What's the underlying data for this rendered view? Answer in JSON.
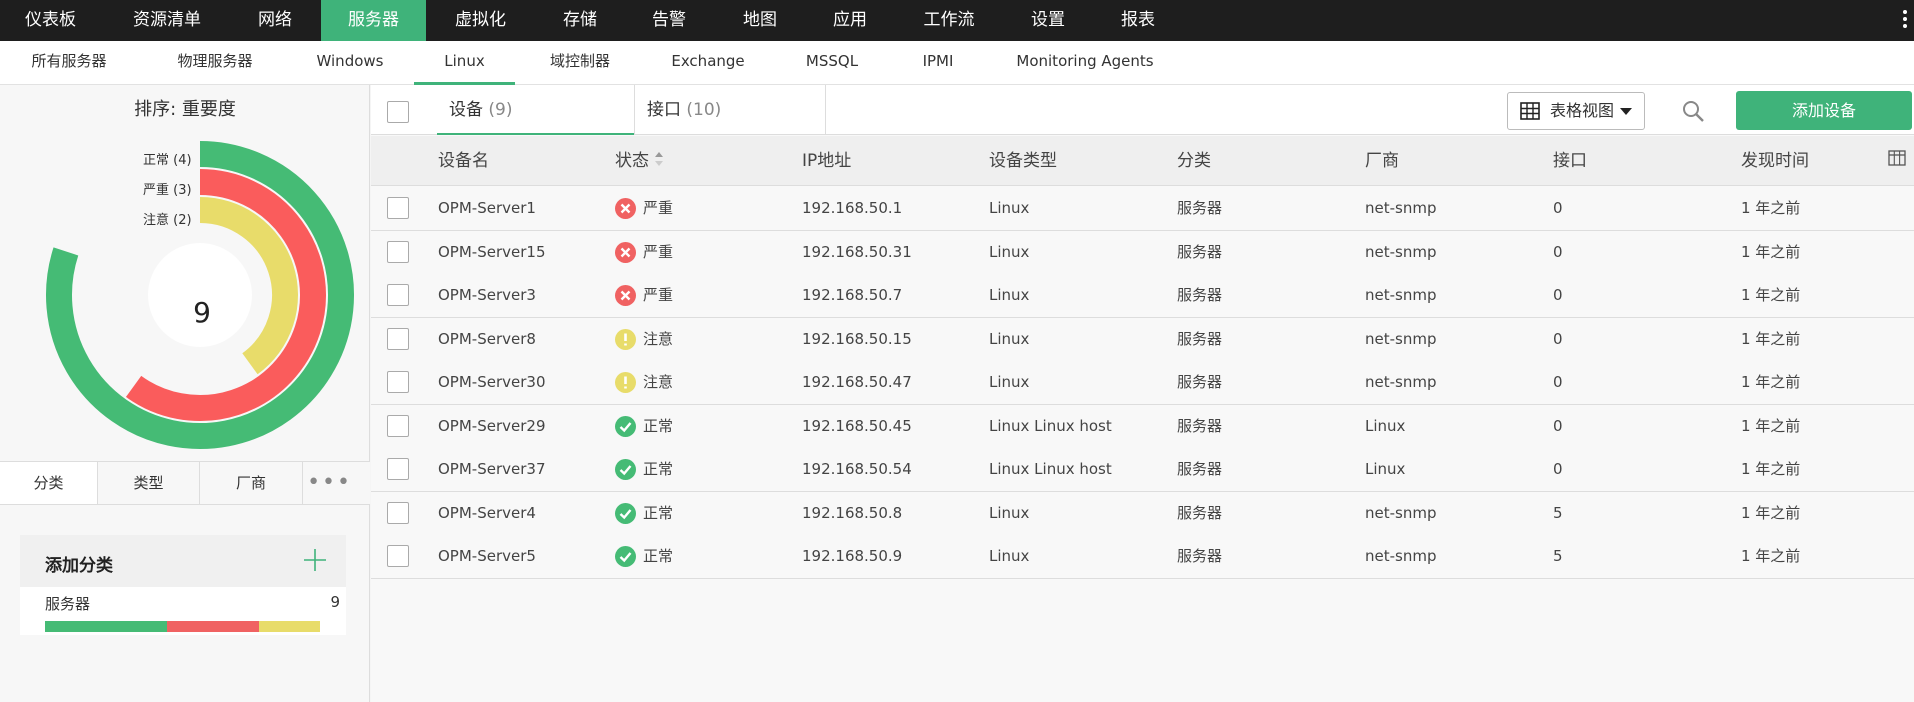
{
  "topnav": [
    "仪表板",
    "资源清单",
    "网络",
    "服务器",
    "虚拟化",
    "存储",
    "告警",
    "地图",
    "应用",
    "工作流",
    "设置",
    "报表"
  ],
  "topnav_active": "服务器",
  "subnav": [
    "所有服务器",
    "物理服务器",
    "Windows",
    "Linux",
    "域控制器",
    "Exchange",
    "MSSQL",
    "IPMI",
    "Monitoring Agents"
  ],
  "subnav_active": "Linux",
  "left": {
    "sort_label": "排序:  重要度",
    "total": "9",
    "legend": [
      {
        "label": "正常 (4)",
        "color": "#45bb75"
      },
      {
        "label": "严重 (3)",
        "color": "#fa5c5c"
      },
      {
        "label": "注意 (2)",
        "color": "#e8dc6a"
      }
    ],
    "donut_fractions": {
      "normal": 0.8,
      "critical": 0.6,
      "attention": 0.4
    },
    "tabs": [
      "分类",
      "类型",
      "厂商"
    ],
    "category_header": "添加分类",
    "category": {
      "name": "服务器",
      "count": "9",
      "bar": [
        0.4,
        0.3,
        0.2
      ]
    }
  },
  "toolbar": {
    "tab_devices": "设备",
    "tab_devices_count": "(9)",
    "tab_interfaces": "接口",
    "tab_interfaces_count": "(10)",
    "view_label": "表格视图",
    "add_label": "添加设备"
  },
  "table": {
    "headers": [
      "设备名",
      "状态",
      "IP地址",
      "设备类型",
      "分类",
      "厂商",
      "接口",
      "发现时间"
    ],
    "rows": [
      {
        "name": "OPM-Server1",
        "status": "严重",
        "kind": "critical",
        "ip": "192.168.50.1",
        "type": "Linux",
        "cat": "服务器",
        "vendor": "net-snmp",
        "ifc": "0",
        "time": "1 年之前"
      },
      {
        "name": "OPM-Server15",
        "status": "严重",
        "kind": "critical",
        "ip": "192.168.50.31",
        "type": "Linux",
        "cat": "服务器",
        "vendor": "net-snmp",
        "ifc": "0",
        "time": "1 年之前"
      },
      {
        "name": "OPM-Server3",
        "status": "严重",
        "kind": "critical",
        "ip": "192.168.50.7",
        "type": "Linux",
        "cat": "服务器",
        "vendor": "net-snmp",
        "ifc": "0",
        "time": "1 年之前"
      },
      {
        "name": "OPM-Server8",
        "status": "注意",
        "kind": "attention",
        "ip": "192.168.50.15",
        "type": "Linux",
        "cat": "服务器",
        "vendor": "net-snmp",
        "ifc": "0",
        "time": "1 年之前"
      },
      {
        "name": "OPM-Server30",
        "status": "注意",
        "kind": "attention",
        "ip": "192.168.50.47",
        "type": "Linux",
        "cat": "服务器",
        "vendor": "net-snmp",
        "ifc": "0",
        "time": "1 年之前"
      },
      {
        "name": "OPM-Server29",
        "status": "正常",
        "kind": "normal",
        "ip": "192.168.50.45",
        "type": "Linux Linux host",
        "cat": "服务器",
        "vendor": "Linux",
        "ifc": "0",
        "time": "1 年之前"
      },
      {
        "name": "OPM-Server37",
        "status": "正常",
        "kind": "normal",
        "ip": "192.168.50.54",
        "type": "Linux Linux host",
        "cat": "服务器",
        "vendor": "Linux",
        "ifc": "0",
        "time": "1 年之前"
      },
      {
        "name": "OPM-Server4",
        "status": "正常",
        "kind": "normal",
        "ip": "192.168.50.8",
        "type": "Linux",
        "cat": "服务器",
        "vendor": "net-snmp",
        "ifc": "5",
        "time": "1 年之前"
      },
      {
        "name": "OPM-Server5",
        "status": "正常",
        "kind": "normal",
        "ip": "192.168.50.9",
        "type": "Linux",
        "cat": "服务器",
        "vendor": "net-snmp",
        "ifc": "5",
        "time": "1 年之前"
      }
    ]
  },
  "colors": {
    "accent": "#3fb37a",
    "critical": "#f06262",
    "attention": "#e8dc6a",
    "normal": "#45bb75"
  }
}
